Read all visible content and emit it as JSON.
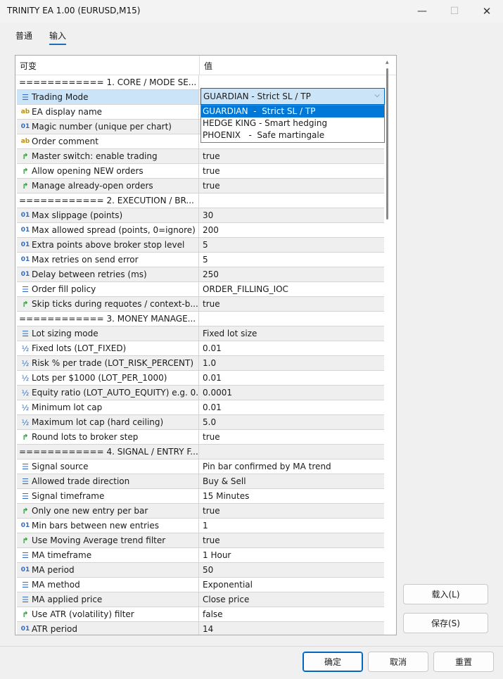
{
  "window": {
    "title": "TRINITY EA 1.00 (EURUSD,M15)",
    "min_icon": "—",
    "max_icon": "☐",
    "close_icon": "✕"
  },
  "tabs": [
    {
      "label": "普通"
    },
    {
      "label": "输入"
    }
  ],
  "grid": {
    "col_variable": "可变",
    "col_value": "值"
  },
  "rows": [
    {
      "type": "sep",
      "name": "============ 1. CORE  /  MODE SE...",
      "value": ""
    },
    {
      "type": "enum",
      "name": "Trading Mode",
      "value": ""
    },
    {
      "type": "str",
      "name": "EA display name",
      "value": ""
    },
    {
      "type": "int",
      "name": "Magic number (unique per chart)",
      "value": ""
    },
    {
      "type": "str",
      "name": "Order comment",
      "value": ""
    },
    {
      "type": "bool",
      "name": "Master switch: enable trading",
      "value": "true"
    },
    {
      "type": "bool",
      "name": "Allow opening NEW orders",
      "value": "true"
    },
    {
      "type": "bool",
      "name": "Manage already-open orders",
      "value": "true"
    },
    {
      "type": "sep",
      "name": "============ 2. EXECUTION  /  BR...",
      "value": ""
    },
    {
      "type": "int",
      "name": "Max slippage (points)",
      "value": "30"
    },
    {
      "type": "int",
      "name": "Max allowed spread (points, 0=ignore)",
      "value": "200"
    },
    {
      "type": "int",
      "name": "Extra points above broker stop level",
      "value": "5"
    },
    {
      "type": "int",
      "name": "Max retries on send error",
      "value": "5"
    },
    {
      "type": "int",
      "name": "Delay between retries (ms)",
      "value": "250"
    },
    {
      "type": "enum",
      "name": "Order fill policy",
      "value": "ORDER_FILLING_IOC"
    },
    {
      "type": "bool",
      "name": "Skip ticks during requotes / context-b...",
      "value": "true"
    },
    {
      "type": "sep",
      "name": "============ 3. MONEY MANAGE...",
      "value": ""
    },
    {
      "type": "enum",
      "name": "Lot sizing mode",
      "value": "Fixed lot size"
    },
    {
      "type": "dbl",
      "name": "Fixed lots (LOT_FIXED)",
      "value": "0.01"
    },
    {
      "type": "dbl",
      "name": "Risk % per trade (LOT_RISK_PERCENT)",
      "value": "1.0"
    },
    {
      "type": "dbl",
      "name": "Lots per $1000 (LOT_PER_1000)",
      "value": "0.01"
    },
    {
      "type": "dbl",
      "name": "Equity ratio (LOT_AUTO_EQUITY) e.g. 0...",
      "value": "0.0001"
    },
    {
      "type": "dbl",
      "name": "Minimum lot cap",
      "value": "0.01"
    },
    {
      "type": "dbl",
      "name": "Maximum lot cap (hard ceiling)",
      "value": "5.0"
    },
    {
      "type": "bool",
      "name": "Round lots to broker step",
      "value": "true"
    },
    {
      "type": "sep",
      "name": "============ 4. SIGNAL  /  ENTRY F...",
      "value": ""
    },
    {
      "type": "enum",
      "name": "Signal source",
      "value": "Pin bar confirmed by MA trend"
    },
    {
      "type": "enum",
      "name": "Allowed trade direction",
      "value": "Buy & Sell"
    },
    {
      "type": "enum",
      "name": "Signal timeframe",
      "value": "15 Minutes"
    },
    {
      "type": "bool",
      "name": "Only one new entry per bar",
      "value": "true"
    },
    {
      "type": "int",
      "name": "Min bars between new entries",
      "value": "1"
    },
    {
      "type": "bool",
      "name": "Use Moving Average trend filter",
      "value": "true"
    },
    {
      "type": "enum",
      "name": "MA timeframe",
      "value": "1 Hour"
    },
    {
      "type": "int",
      "name": "MA period",
      "value": "50"
    },
    {
      "type": "enum",
      "name": "MA method",
      "value": "Exponential"
    },
    {
      "type": "enum",
      "name": "MA applied price",
      "value": "Close price"
    },
    {
      "type": "bool",
      "name": "Use ATR (volatility) filter",
      "value": "false"
    },
    {
      "type": "int",
      "name": "ATR period",
      "value": "14"
    }
  ],
  "icons": {
    "enum": "☰",
    "str": "ab",
    "int": "01",
    "bool": "↱",
    "dbl": "½"
  },
  "combo": {
    "selected": "GUARDIAN  -  Strict SL / TP",
    "chevron": "⌵",
    "options": [
      "GUARDIAN  -  Strict SL / TP",
      "HEDGE KING - Smart hedging",
      "PHOENIX   -  Safe martingale"
    ]
  },
  "buttons": {
    "load": "载入(L)",
    "save": "保存(S)",
    "ok": "确定",
    "cancel": "取消",
    "reset": "重置"
  },
  "colors": {
    "accent": "#0078d7",
    "selection": "#cce4f7",
    "bool_icon": "#2f9a39",
    "string_icon": "#b89014",
    "numeric_icon": "#2d6cc0"
  }
}
